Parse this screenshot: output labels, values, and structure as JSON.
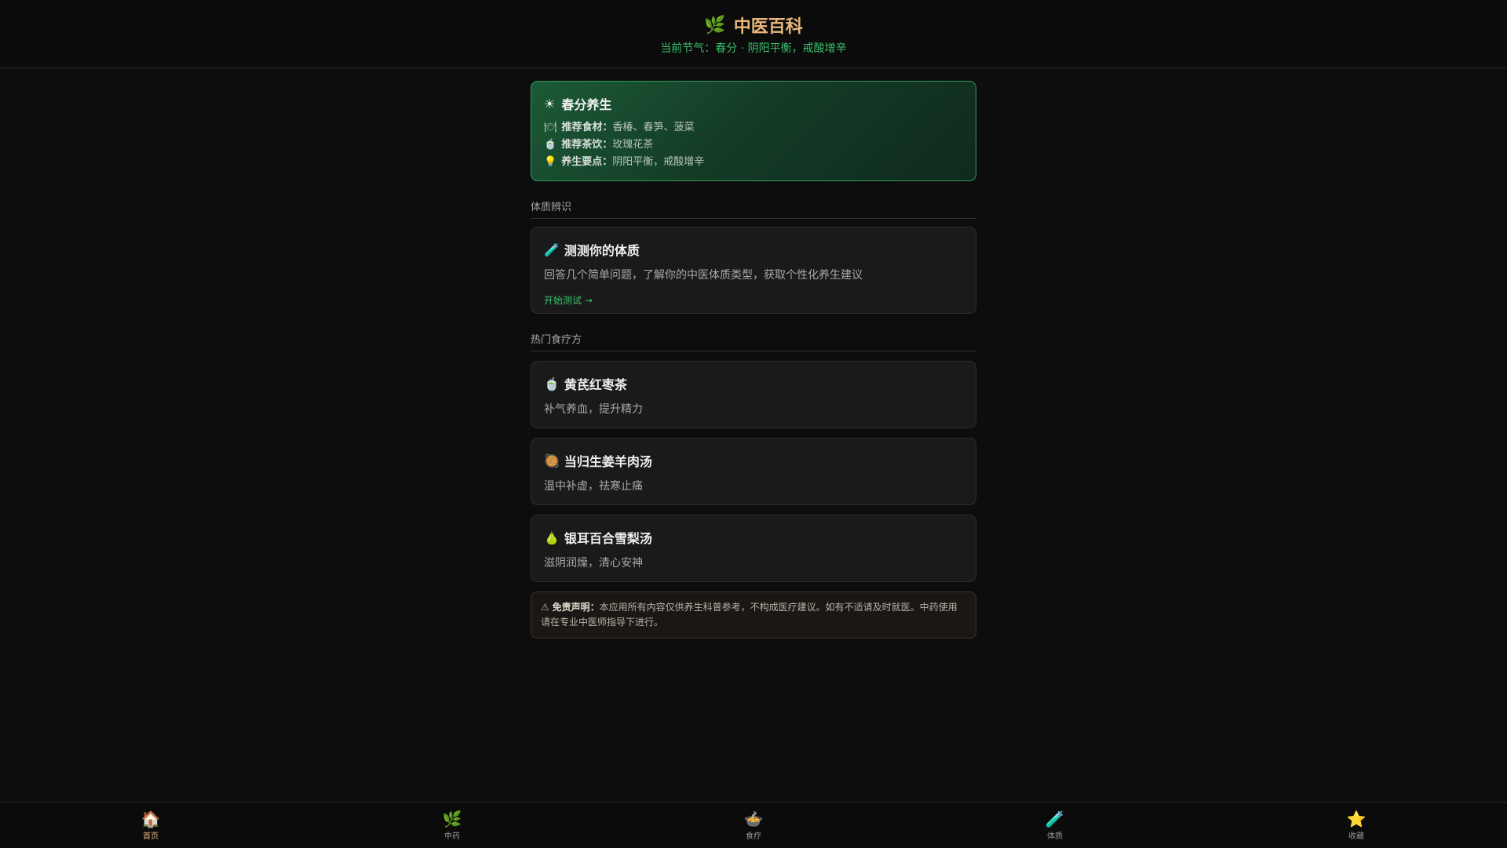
{
  "header": {
    "icon": "🌿",
    "title": "中医百科",
    "subtitle": "当前节气：春分 · 阴阳平衡，戒酸增辛"
  },
  "season": {
    "icon": "☀",
    "title": "春分养生",
    "items": [
      {
        "icon": "🍽",
        "label": "推荐食材：",
        "value": "香椿、春笋、菠菜"
      },
      {
        "icon": "🍵",
        "label": "推荐茶饮：",
        "value": "玫瑰花茶"
      },
      {
        "icon": "💡",
        "label": "养生要点：",
        "value": "阴阳平衡，戒酸增辛"
      }
    ]
  },
  "constitution": {
    "section": "体质辨识",
    "icon": "🧪",
    "title": "测测你的体质",
    "desc": "回答几个简单问题，了解你的中医体质类型，获取个性化养生建议",
    "link": "开始测试 →"
  },
  "recipes": {
    "section": "热门食疗方",
    "items": [
      {
        "icon": "🍵",
        "title": "黄芪红枣茶",
        "desc": "补气养血，提升精力"
      },
      {
        "icon": "🥘",
        "title": "当归生姜羊肉汤",
        "desc": "温中补虚，祛寒止痛"
      },
      {
        "icon": "🍐",
        "title": "银耳百合雪梨汤",
        "desc": "滋阴润燥，清心安神"
      }
    ]
  },
  "disclaimer": {
    "icon": "⚠",
    "label": "免责声明：",
    "text": "本应用所有内容仅供养生科普参考，不构成医疗建议。如有不适请及时就医。中药使用请在专业中医师指导下进行。"
  },
  "nav": [
    {
      "icon": "🏠",
      "label": "首页",
      "active": true
    },
    {
      "icon": "🌿",
      "label": "中药",
      "active": false
    },
    {
      "icon": "🍲",
      "label": "食疗",
      "active": false
    },
    {
      "icon": "🧪",
      "label": "体质",
      "active": false
    },
    {
      "icon": "⭐",
      "label": "收藏",
      "active": false
    }
  ],
  "colors": {
    "accent_gold": "#e9b77d",
    "accent_green": "#39c06b",
    "background": "#0d0d0d"
  }
}
